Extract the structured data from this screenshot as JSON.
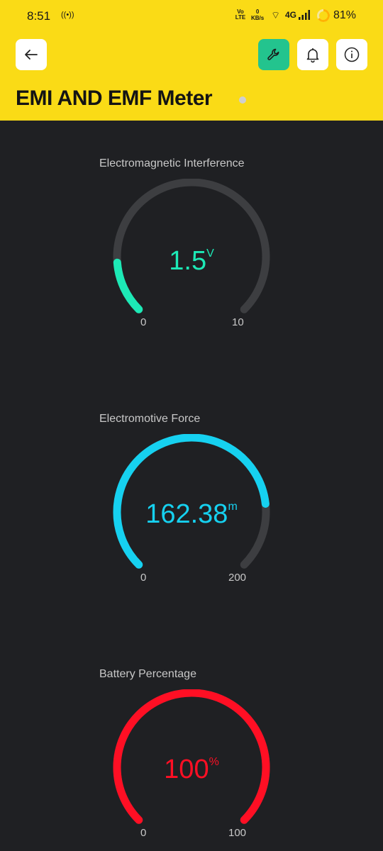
{
  "status_bar": {
    "time": "8:51",
    "volte": "Vo LTE",
    "speed_value": "0",
    "speed_unit": "KB/s",
    "network": "4G",
    "battery": "81%"
  },
  "header": {
    "title": "EMI AND EMF Meter",
    "background": "#fadb16",
    "buttons": {
      "back_icon": "arrow-left-icon",
      "settings_icon": "wrench-icon",
      "notifications_icon": "bell-icon",
      "info_icon": "info-icon"
    }
  },
  "gauges": [
    {
      "label": "Electromagnetic Interference",
      "value": "1.5",
      "unit": "V",
      "min": "0",
      "max": "10",
      "fraction": 0.15,
      "color": "#1de9b6"
    },
    {
      "label": "Electromotive Force",
      "value": "162.38",
      "unit": "m",
      "min": "0",
      "max": "200",
      "fraction": 0.81,
      "color": "#16d1f0"
    },
    {
      "label": "Battery Percentage",
      "value": "100",
      "unit": "%",
      "min": "0",
      "max": "100",
      "fraction": 1.0,
      "color": "#ff0f24"
    }
  ],
  "track_color": "#3d3e41"
}
